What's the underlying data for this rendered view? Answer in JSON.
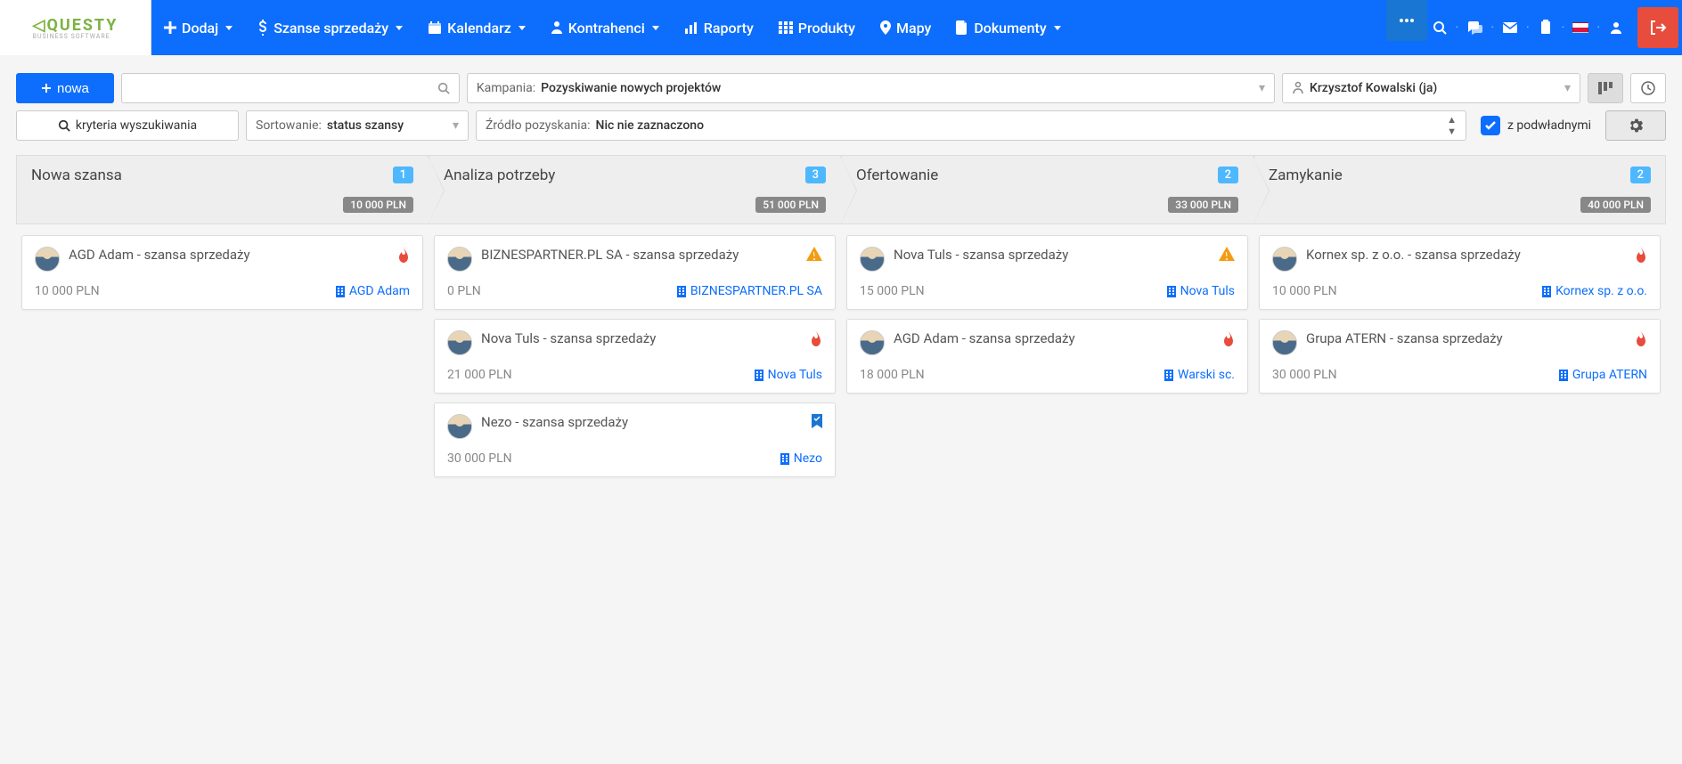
{
  "nav": {
    "logo_main": "QUESTY",
    "logo_sub": "BUSINESS SOFTWARE",
    "items": [
      {
        "label": "Dodaj",
        "icon": "plus",
        "caret": true
      },
      {
        "label": "Szanse sprzedaży",
        "icon": "dollar",
        "caret": true
      },
      {
        "label": "Kalendarz",
        "icon": "calendar",
        "caret": true
      },
      {
        "label": "Kontrahenci",
        "icon": "user",
        "caret": true
      },
      {
        "label": "Raporty",
        "icon": "chart",
        "caret": false
      },
      {
        "label": "Produkty",
        "icon": "grid",
        "caret": false
      },
      {
        "label": "Mapy",
        "icon": "pin",
        "caret": false
      },
      {
        "label": "Dokumenty",
        "icon": "doc",
        "caret": true
      }
    ]
  },
  "filters": {
    "new_btn": "nowa",
    "kryteria": "kryteria wyszukiwania",
    "sort_label": "Sortowanie:",
    "sort_value": "status szansy",
    "kampania_label": "Kampania:",
    "kampania_value": "Pozyskiwanie nowych projektów",
    "zrodlo_label": "Źródło pozyskania:",
    "zrodlo_value": "Nic nie zaznaczono",
    "owner": "Krzysztof Kowalski (ja)",
    "sub_checkbox": "z podwładnymi"
  },
  "columns": [
    {
      "title": "Nowa szansa",
      "count": "1",
      "amount": "10 000 PLN",
      "cards": [
        {
          "title": "AGD Adam - szansa sprzedaży",
          "amount": "10 000 PLN",
          "company": "AGD Adam",
          "status": "fire"
        }
      ]
    },
    {
      "title": "Analiza potrzeby",
      "count": "3",
      "amount": "51 000 PLN",
      "cards": [
        {
          "title": "BIZNESPARTNER.PL SA - szansa sprzedaży",
          "amount": "0 PLN",
          "company": "BIZNESPARTNER.PL SA",
          "status": "warn"
        },
        {
          "title": "Nova Tuls - szansa sprzedaży",
          "amount": "21 000 PLN",
          "company": "Nova Tuls",
          "status": "fire"
        },
        {
          "title": "Nezo - szansa sprzedaży",
          "amount": "30 000 PLN",
          "company": "Nezo",
          "status": "bookmark"
        }
      ]
    },
    {
      "title": "Ofertowanie",
      "count": "2",
      "amount": "33 000 PLN",
      "cards": [
        {
          "title": "Nova Tuls - szansa sprzedaży",
          "amount": "15 000 PLN",
          "company": "Nova Tuls",
          "status": "warn"
        },
        {
          "title": "AGD Adam - szansa sprzedaży",
          "amount": "18 000 PLN",
          "company": "Warski sc.",
          "status": "fire"
        }
      ]
    },
    {
      "title": "Zamykanie",
      "count": "2",
      "amount": "40 000 PLN",
      "cards": [
        {
          "title": "Kornex sp. z o.o. - szansa sprzedaży",
          "amount": "10 000 PLN",
          "company": "Kornex sp. z o.o.",
          "status": "fire"
        },
        {
          "title": "Grupa ATERN - szansa sprzedaży",
          "amount": "30 000 PLN",
          "company": "Grupa ATERN",
          "status": "fire"
        }
      ]
    }
  ]
}
